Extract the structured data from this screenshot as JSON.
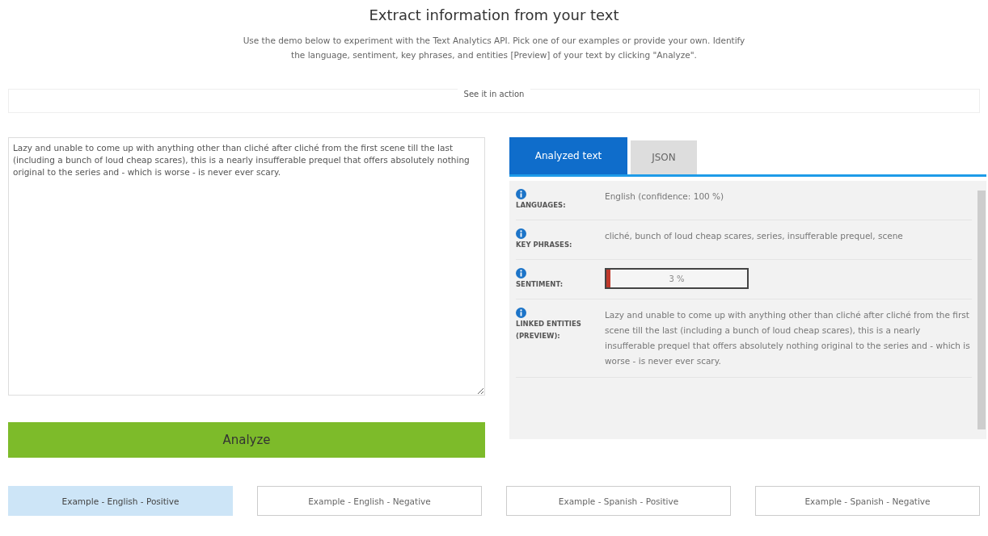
{
  "heading": "Extract information from your text",
  "description": "Use the demo below to experiment with the Text Analytics API. Pick one of our examples or provide your own. Identify the language, sentiment, key phrases, and entities [Preview] of your text by clicking \"Analyze\".",
  "section_label": "See it in action",
  "input_text": "Lazy and unable to come up with anything other than cliché after cliché from the first scene till the last (including a bunch of loud cheap scares), this is a nearly insufferable prequel that offers absolutely nothing original to the series and - which is worse - is never ever scary.",
  "analyze_button": "Analyze",
  "tabs": [
    {
      "label": "Analyzed text",
      "selected": true
    },
    {
      "label": "JSON",
      "selected": false
    }
  ],
  "results": [
    {
      "kind": "text",
      "label": "LANGUAGES:",
      "value": "English (confidence: 100 %)"
    },
    {
      "kind": "text",
      "label": "KEY PHRASES:",
      "value": "cliché, bunch of loud cheap scares, series, insufferable prequel, scene"
    },
    {
      "kind": "meter",
      "label": "SENTIMENT:",
      "level": 0.03,
      "reading": "3 %"
    },
    {
      "kind": "text",
      "label": "LINKED ENTITIES (PREVIEW):",
      "value": "Lazy and unable to come up with anything other than cliché after cliché from the first scene till the last (including a bunch of loud cheap scares), this is a nearly insufferable prequel that offers absolutely nothing original to the series and - which is worse - is never ever scary."
    }
  ],
  "examples": [
    {
      "label": "Example - English - Positive",
      "selected": true
    },
    {
      "label": "Example - English - Negative",
      "selected": false
    },
    {
      "label": "Example - Spanish - Positive",
      "selected": false
    },
    {
      "label": "Example - Spanish - Negative",
      "selected": false
    }
  ]
}
